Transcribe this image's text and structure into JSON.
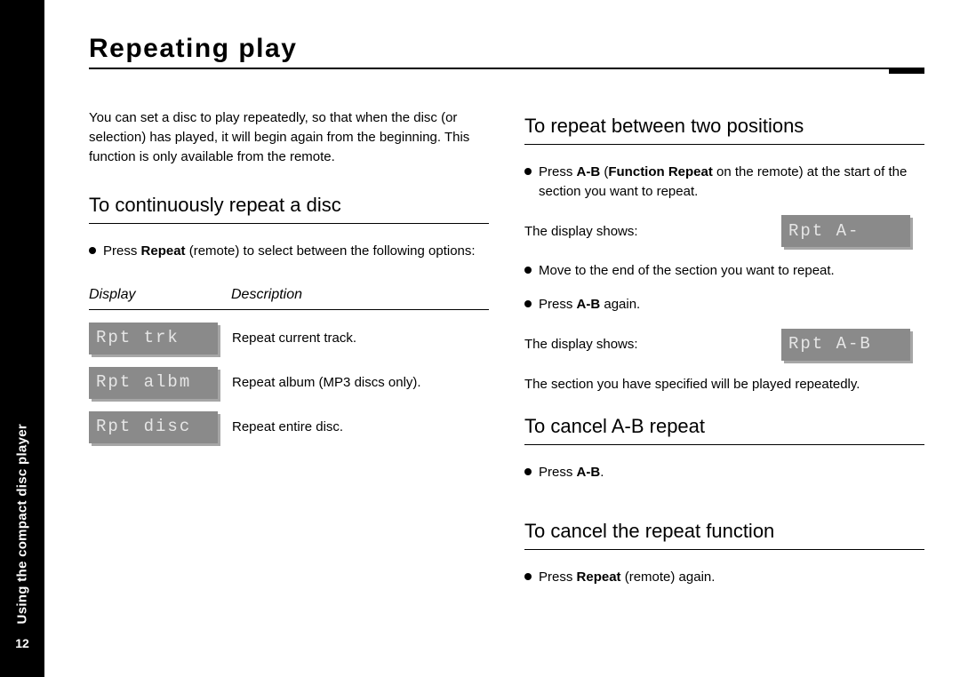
{
  "sidebar": {
    "chapter": "Using the compact disc player",
    "page_number": "12"
  },
  "title": "Repeating play",
  "left": {
    "intro": "You can set a disc to play repeatedly, so that when the disc (or selection) has played, it will begin again from the beginning. This function is only available from the remote.",
    "section1_title": "To continuously repeat a disc",
    "bullet1_prefix": "Press ",
    "bullet1_bold": "Repeat",
    "bullet1_suffix": " (remote) to select between the following options:",
    "table": {
      "header_display": "Display",
      "header_desc": "Description",
      "rows": [
        {
          "lcd": "Rpt trk",
          "desc": "Repeat current track."
        },
        {
          "lcd": "Rpt albm",
          "desc": "Repeat album (MP3 discs only)."
        },
        {
          "lcd": "Rpt disc",
          "desc": "Repeat entire disc."
        }
      ]
    }
  },
  "right": {
    "section2_title": "To repeat between two positions",
    "r2_b1_prefix": "Press ",
    "r2_b1_bold1": "A-B",
    "r2_b1_mid": " (",
    "r2_b1_bold2": "Function Repeat",
    "r2_b1_suffix": " on the remote) at the start of the section you want to repeat.",
    "display_shows": "The display shows:",
    "lcd_a": "Rpt A-",
    "r2_b2": "Move to the end of the section you want to repeat.",
    "r2_b3_prefix": "Press ",
    "r2_b3_bold": "A-B",
    "r2_b3_suffix": " again.",
    "lcd_ab": "Rpt A-B",
    "r2_outro": "The section you have specified will be played repeatedly.",
    "section3_title": "To cancel A-B repeat",
    "r3_b1_prefix": "Press ",
    "r3_b1_bold": "A-B",
    "r3_b1_suffix": ".",
    "section4_title": "To cancel the repeat function",
    "r4_b1_prefix": "Press ",
    "r4_b1_bold": "Repeat",
    "r4_b1_suffix": " (remote) again."
  }
}
